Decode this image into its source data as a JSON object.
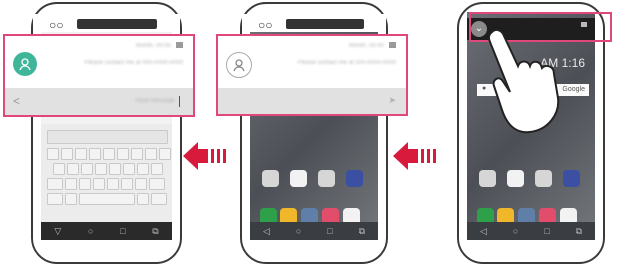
{
  "notification": {
    "sender_time": "Month, 00:00",
    "message": "Please contact me at 000-0000-0000",
    "reply_hint": "Input message"
  },
  "clock": "AM 1:16",
  "google_label": "Google",
  "colors": {
    "highlight": "#e0477a",
    "avatar": "#3fb59a",
    "arrow": "#d81b3c"
  },
  "icons": [
    "person-icon",
    "share-icon",
    "send-icon",
    "chevron-down-icon",
    "hand-icon",
    "arrow-left-icon",
    "mic-icon"
  ]
}
